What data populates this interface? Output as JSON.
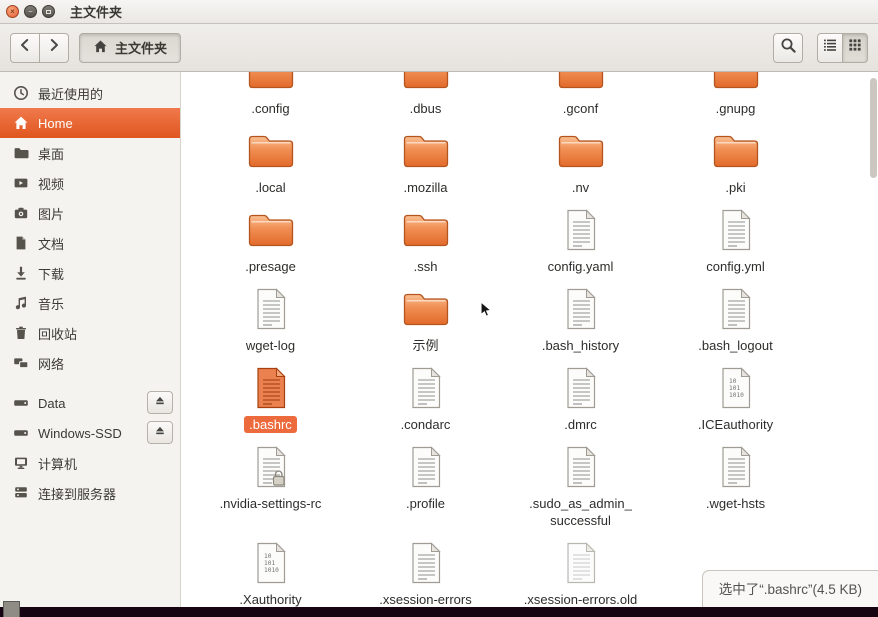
{
  "window": {
    "title": "主文件夹"
  },
  "toolbar": {
    "path_label": "主文件夹"
  },
  "colors": {
    "accent": "#ec6a3c",
    "sidebar_active_top": "#f0794c",
    "sidebar_active_bottom": "#e0561f",
    "desktop_strip": "#160412"
  },
  "sidebar": {
    "items": [
      {
        "id": "recent",
        "label": "最近使用的",
        "icon": "clock"
      },
      {
        "id": "home",
        "label": "Home",
        "icon": "home",
        "active": true
      },
      {
        "id": "desktop",
        "label": "桌面",
        "icon": "folder"
      },
      {
        "id": "videos",
        "label": "视频",
        "icon": "video"
      },
      {
        "id": "pictures",
        "label": "图片",
        "icon": "photo"
      },
      {
        "id": "documents",
        "label": "文档",
        "icon": "document"
      },
      {
        "id": "downloads",
        "label": "下载",
        "icon": "download"
      },
      {
        "id": "music",
        "label": "音乐",
        "icon": "music"
      },
      {
        "id": "trash",
        "label": "回收站",
        "icon": "trash"
      },
      {
        "id": "network",
        "label": "网络",
        "icon": "network"
      },
      {
        "id": "data",
        "label": "Data",
        "icon": "drive",
        "eject": true,
        "gap": true
      },
      {
        "id": "windows-ssd",
        "label": "Windows-SSD",
        "icon": "drive",
        "eject": true
      },
      {
        "id": "computer",
        "label": "计算机",
        "icon": "computer"
      },
      {
        "id": "server",
        "label": "连接到服务器",
        "icon": "server"
      }
    ]
  },
  "files": [
    {
      "name": ".config",
      "type": "folder"
    },
    {
      "name": ".dbus",
      "type": "folder"
    },
    {
      "name": ".gconf",
      "type": "folder"
    },
    {
      "name": ".gnupg",
      "type": "folder"
    },
    {
      "name": ".local",
      "type": "folder"
    },
    {
      "name": ".mozilla",
      "type": "folder"
    },
    {
      "name": ".nv",
      "type": "folder"
    },
    {
      "name": ".pki",
      "type": "folder"
    },
    {
      "name": ".presage",
      "type": "folder"
    },
    {
      "name": ".ssh",
      "type": "folder"
    },
    {
      "name": "config.yaml",
      "type": "file"
    },
    {
      "name": "config.yml",
      "type": "file"
    },
    {
      "name": "wget-log",
      "type": "file"
    },
    {
      "name": "示例",
      "type": "folder",
      "cursor": true
    },
    {
      "name": ".bash_history",
      "type": "file"
    },
    {
      "name": ".bash_logout",
      "type": "file"
    },
    {
      "name": ".bashrc",
      "type": "file",
      "selected": true
    },
    {
      "name": ".condarc",
      "type": "file"
    },
    {
      "name": ".dmrc",
      "type": "file"
    },
    {
      "name": ".ICEauthority",
      "type": "binary"
    },
    {
      "name": ".nvidia-settings-rc",
      "type": "file",
      "lock": true
    },
    {
      "name": ".profile",
      "type": "file"
    },
    {
      "name": ".sudo_as_admin_successful",
      "type": "file",
      "display": ".sudo_as_admin_\nsuccessful"
    },
    {
      "name": ".wget-hsts",
      "type": "file"
    },
    {
      "name": ".Xauthority",
      "type": "binary"
    },
    {
      "name": ".xsession-errors",
      "type": "file"
    },
    {
      "name": ".xsession-errors.old",
      "type": "file",
      "faded": true
    }
  ],
  "statusbar": {
    "text": "选中了“.bashrc”(4.5 KB)"
  }
}
